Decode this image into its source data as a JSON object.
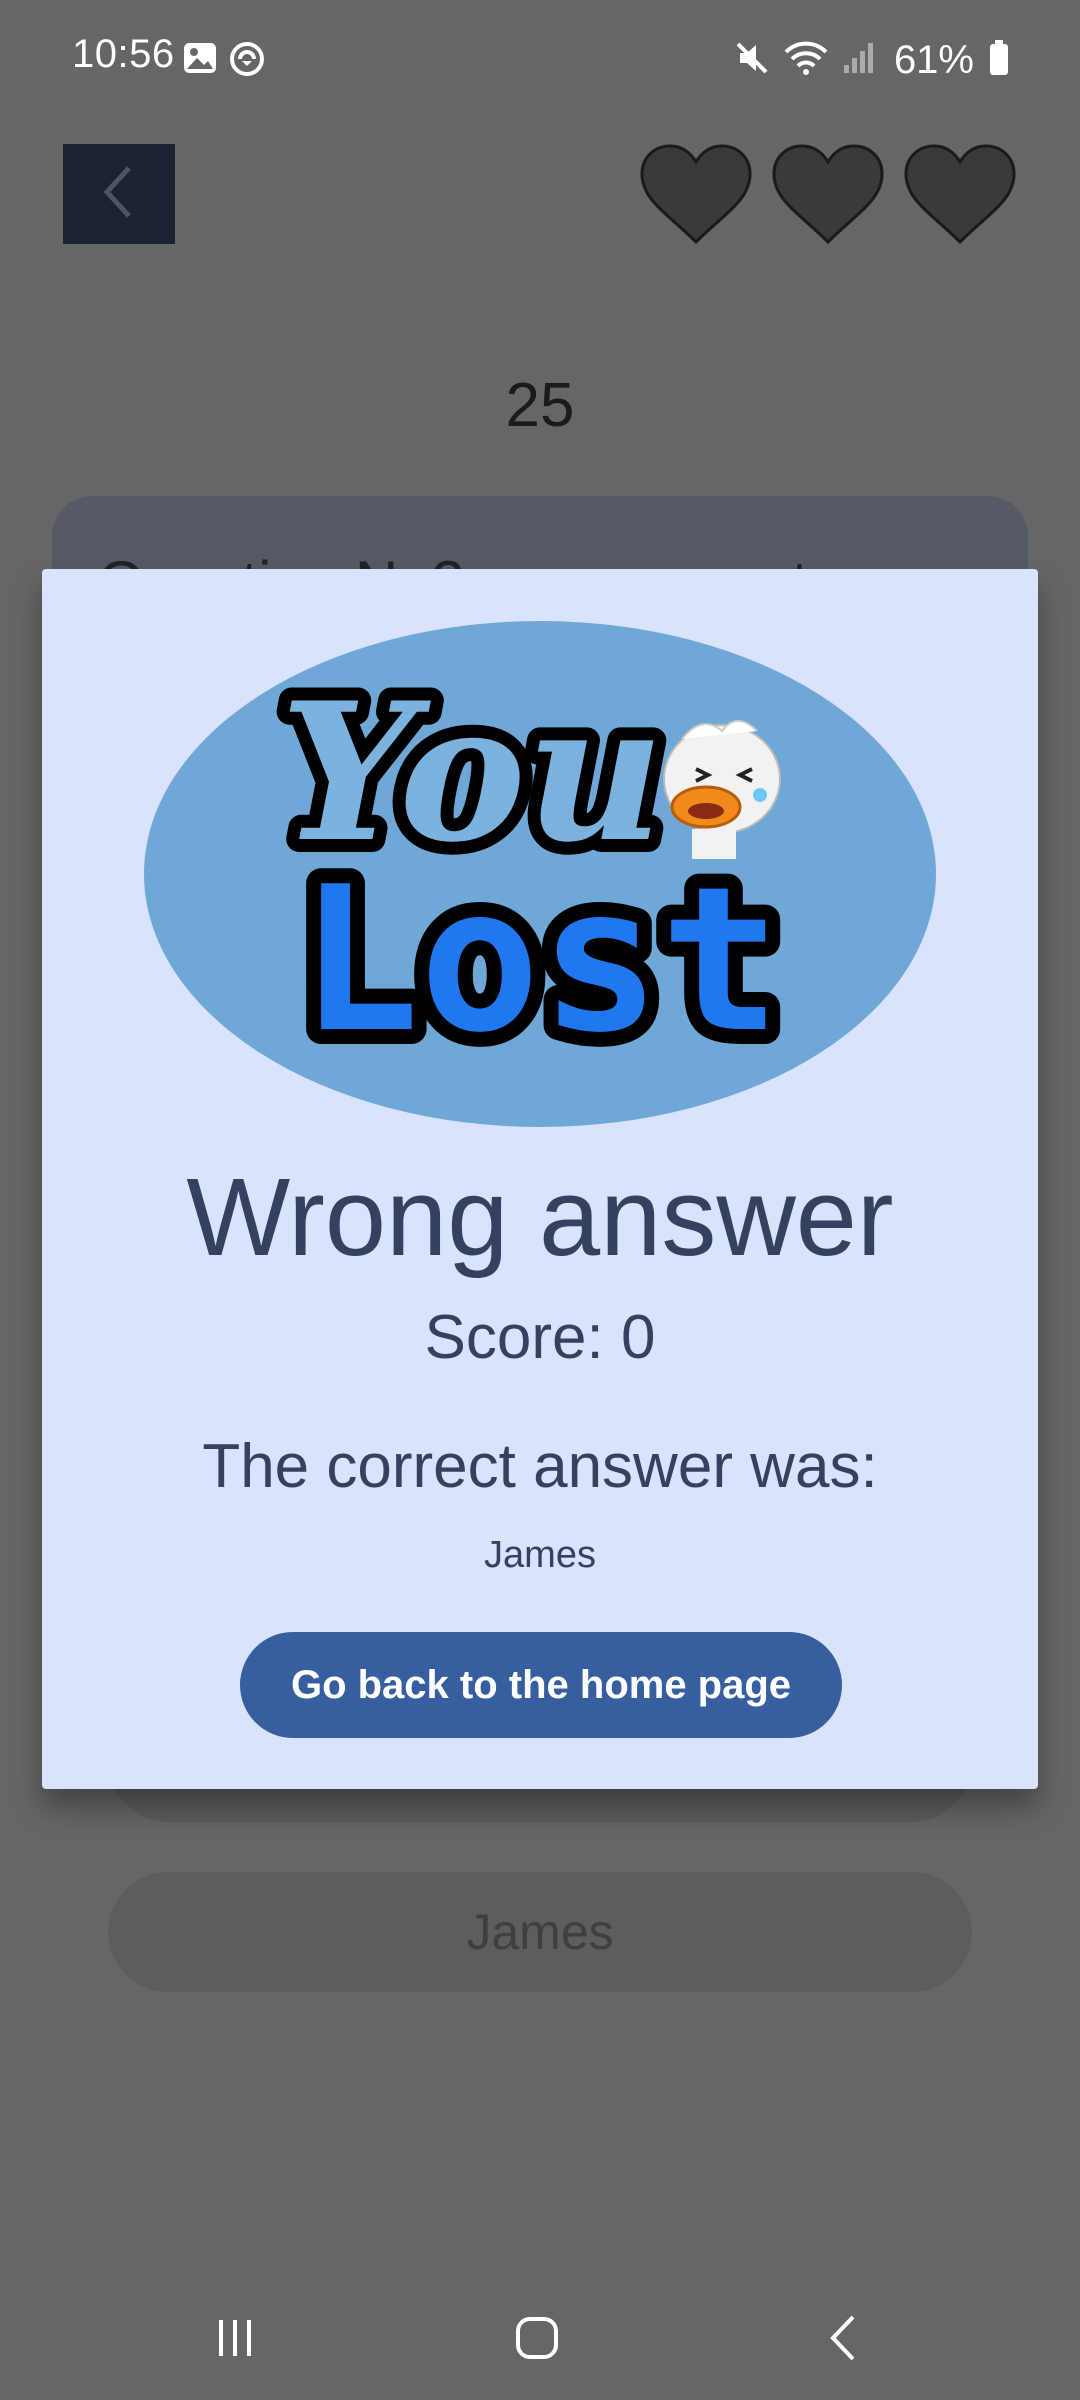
{
  "status_bar": {
    "time": "10:56",
    "battery": "61%",
    "icons": [
      "gallery-icon",
      "sync-icon",
      "mute-icon",
      "wifi-icon",
      "signal-icon",
      "battery-icon"
    ]
  },
  "header": {
    "back_icon": "chevron-left-icon",
    "lives_icon": "heart-icon",
    "timer": "25"
  },
  "question": {
    "text": "Question N. 3 — ... correct answer"
  },
  "options": [
    {
      "label": ""
    },
    {
      "label": "James"
    }
  ],
  "modal": {
    "image_text_top": "You",
    "image_text_bottom": "Lost",
    "title": "Wrong answer",
    "score": "Score: 0",
    "correct_label": "The correct answer was:",
    "correct_answer": "James",
    "home_button": "Go back to the home page"
  },
  "colors": {
    "overlay": "#666666",
    "modal_bg": "#d9e3fb",
    "text": "#35415e",
    "button": "#375e9e"
  }
}
